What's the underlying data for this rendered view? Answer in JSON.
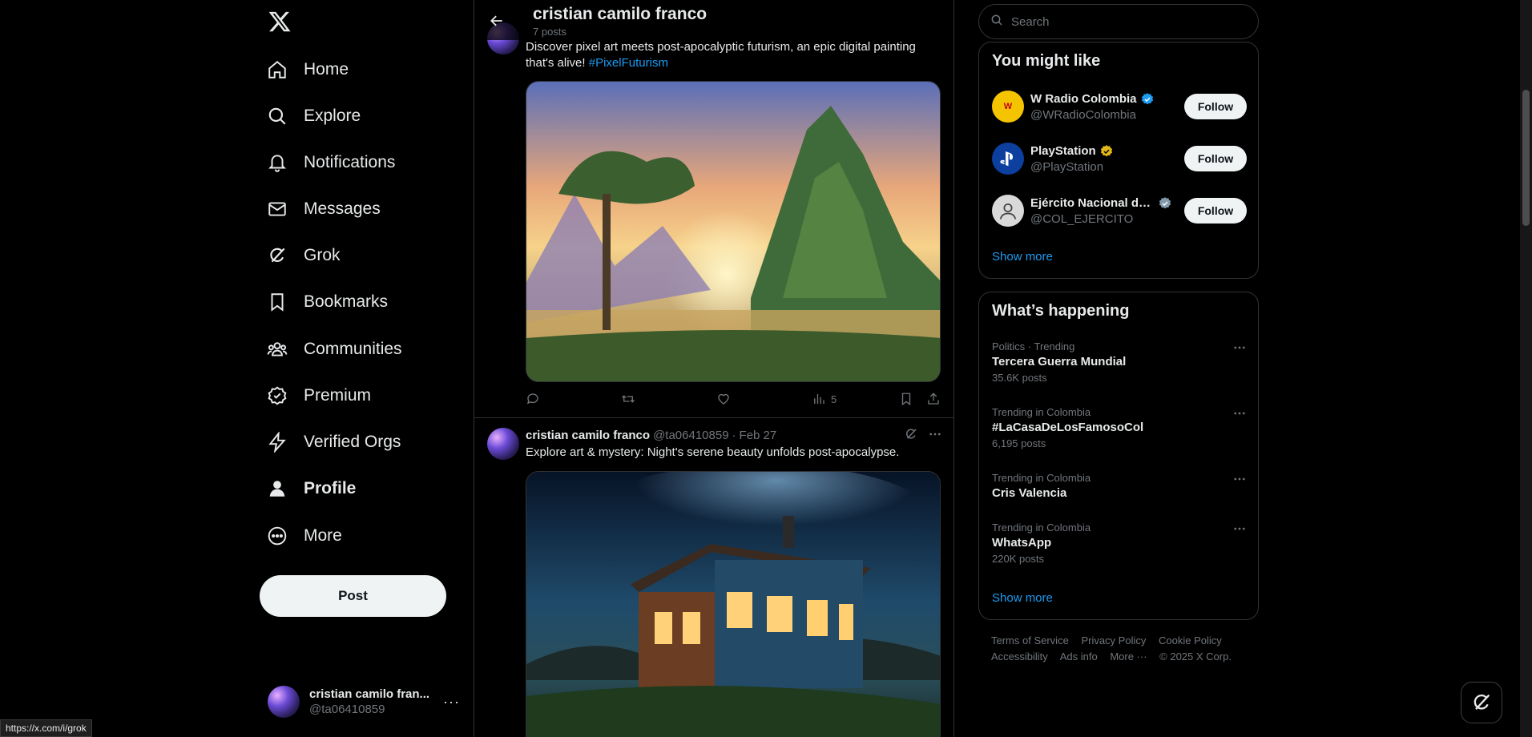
{
  "nav": {
    "items": [
      {
        "label": "Home",
        "icon": "home-icon"
      },
      {
        "label": "Explore",
        "icon": "search-icon"
      },
      {
        "label": "Notifications",
        "icon": "bell-icon"
      },
      {
        "label": "Messages",
        "icon": "mail-icon"
      },
      {
        "label": "Grok",
        "icon": "grok-icon"
      },
      {
        "label": "Bookmarks",
        "icon": "bookmark-icon"
      },
      {
        "label": "Communities",
        "icon": "communities-icon"
      },
      {
        "label": "Premium",
        "icon": "premium-icon"
      },
      {
        "label": "Verified Orgs",
        "icon": "lightning-icon"
      },
      {
        "label": "Profile",
        "icon": "person-icon"
      },
      {
        "label": "More",
        "icon": "more-circle-icon"
      }
    ],
    "post_label": "Post"
  },
  "account": {
    "name": "cristian camilo fran...",
    "handle": "@ta06410859",
    "more": "···"
  },
  "header": {
    "title": "cristian camilo franco",
    "subtitle": "7 posts"
  },
  "tweets": [
    {
      "text": "Discover pixel art meets post-apocalyptic futurism, an epic digital painting that's alive!",
      "hashtag": "#PixelFuturism",
      "views": "5"
    },
    {
      "name": "cristian camilo franco",
      "handle": "@ta06410859",
      "sep": "·",
      "date": "Feb 27",
      "text": "Explore art & mystery: Night's serene beauty unfolds post-apocalypse."
    }
  ],
  "search": {
    "placeholder": "Search"
  },
  "who_to_follow": {
    "title": "You might like",
    "follow_label": "Follow",
    "show_more": "Show more",
    "accounts": [
      {
        "name": "W Radio Colombia",
        "handle": "@WRadioColombia",
        "badge_color": "#1d9bf0"
      },
      {
        "name": "PlayStation",
        "handle": "@PlayStation",
        "badge_color": "#e2b719"
      },
      {
        "name": "Ejército Nacional de...",
        "handle": "@COL_EJERCITO",
        "badge_color": "#829aab"
      }
    ]
  },
  "trends": {
    "title": "What’s happening",
    "show_more": "Show more",
    "items": [
      {
        "context": "Politics · Trending",
        "name": "Tercera Guerra Mundial",
        "count": "35.6K posts"
      },
      {
        "context": "Trending in Colombia",
        "name": "#LaCasaDeLosFamosoCol",
        "count": "6,195 posts"
      },
      {
        "context": "Trending in Colombia",
        "name": "Cris Valencia",
        "count": ""
      },
      {
        "context": "Trending in Colombia",
        "name": "WhatsApp",
        "count": "220K posts"
      }
    ]
  },
  "footer": {
    "links": [
      "Terms of Service",
      "Privacy Policy",
      "Cookie Policy",
      "Accessibility",
      "Ads info",
      "More ···",
      "© 2025 X Corp."
    ]
  },
  "status_url": "https://x.com/i/grok",
  "colors": {
    "accent": "#1d9bf0",
    "background": "#000000",
    "border": "#2f3336",
    "muted": "#71767b"
  }
}
